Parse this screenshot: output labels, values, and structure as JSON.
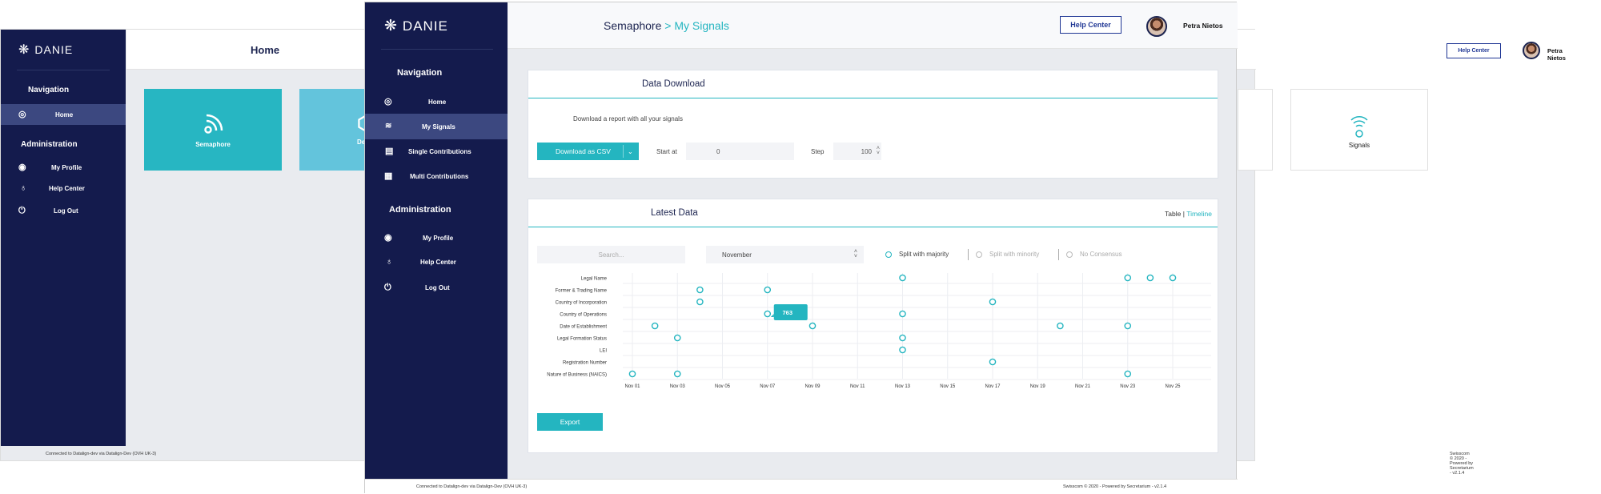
{
  "brand": {
    "name": "DANIE"
  },
  "left_screen": {
    "page_title": "Home",
    "nav_heading": "Navigation",
    "nav": [
      {
        "label": "Home"
      }
    ],
    "admin_heading": "Administration",
    "admin": [
      {
        "label": "My Profile"
      },
      {
        "label": "Help Center"
      },
      {
        "label": "Log Out"
      }
    ],
    "cards": [
      {
        "label": "Semaphore"
      },
      {
        "label": "De"
      },
      {
        "label": "Signals"
      }
    ],
    "footer_left": "Connected to Datalign-dev via Datalign-Dev (OVH UK-3)",
    "footer_right": "Swisscom © 2020 - Powered by Secretarium - v2.1.4",
    "help_button": "Help Center",
    "user_name": "Petra Nietos"
  },
  "main": {
    "breadcrumb": {
      "root": "Semaphore",
      "sep": ">",
      "current": "My Signals"
    },
    "help_button": "Help Center",
    "user_name": "Petra Nietos",
    "nav_heading": "Navigation",
    "nav": [
      {
        "label": "Home"
      },
      {
        "label": "My Signals"
      },
      {
        "label": "Single Contributions"
      },
      {
        "label": "Multi Contributions"
      }
    ],
    "admin_heading": "Administration",
    "admin": [
      {
        "label": "My Profile"
      },
      {
        "label": "Help Center"
      },
      {
        "label": "Log Out"
      }
    ],
    "download": {
      "title": "Data Download",
      "description": "Download a report with all your signals",
      "button": "Download as CSV",
      "start_label": "Start at",
      "start_value": "0",
      "step_label": "Step",
      "step_value": "100"
    },
    "latest": {
      "title": "Latest Data",
      "view_table": "Table",
      "view_sep": "|",
      "view_timeline": "Timeline",
      "search_placeholder": "Search...",
      "month": "November",
      "filters": [
        "Split with majority",
        "Split with minority",
        "No Consensus"
      ],
      "export": "Export"
    },
    "footer_left": "Connected to Datalign-dev via Datalign-Dev (OVH UK-3)",
    "footer_right": "Swisscom © 2020 - Powered by Secretarium - v2.1.4"
  },
  "chart_data": {
    "type": "scatter",
    "categories": [
      "Legal Name",
      "Former & Trading Name",
      "Country of Incorporation",
      "Country of Operations",
      "Date of Establishment",
      "Legal Formation Status",
      "LEI",
      "Registration Number",
      "Nature of Business (NAICS)"
    ],
    "x_ticks": [
      "Nov 01",
      "Nov 03",
      "Nov 05",
      "Nov 07",
      "Nov 09",
      "Nov 11",
      "Nov 13",
      "Nov 15",
      "Nov 17",
      "Nov 19",
      "Nov 21",
      "Nov 23",
      "Nov 25"
    ],
    "xlim": [
      1,
      25
    ],
    "points": [
      {
        "category": "Legal Name",
        "day": 13
      },
      {
        "category": "Legal Name",
        "day": 23
      },
      {
        "category": "Legal Name",
        "day": 24
      },
      {
        "category": "Legal Name",
        "day": 25
      },
      {
        "category": "Former & Trading Name",
        "day": 4
      },
      {
        "category": "Former & Trading Name",
        "day": 7
      },
      {
        "category": "Country of Incorporation",
        "day": 4
      },
      {
        "category": "Country of Incorporation",
        "day": 17
      },
      {
        "category": "Country of Operations",
        "day": 7
      },
      {
        "category": "Country of Operations",
        "day": 13
      },
      {
        "category": "Date of Establishment",
        "day": 2
      },
      {
        "category": "Date of Establishment",
        "day": 9
      },
      {
        "category": "Date of Establishment",
        "day": 20
      },
      {
        "category": "Date of Establishment",
        "day": 23
      },
      {
        "category": "Legal Formation Status",
        "day": 3
      },
      {
        "category": "Legal Formation Status",
        "day": 13
      },
      {
        "category": "LEI",
        "day": 13
      },
      {
        "category": "Registration Number",
        "day": 17
      },
      {
        "category": "Nature of Business (NAICS)",
        "day": 1
      },
      {
        "category": "Nature of Business (NAICS)",
        "day": 3
      },
      {
        "category": "Nature of Business (NAICS)",
        "day": 23
      }
    ],
    "tooltip": {
      "category": "Country of Operations",
      "day": 7,
      "value": "763"
    },
    "grid": true,
    "colors": {
      "point": "#24b5c0",
      "tooltip": "#24b5c0"
    }
  },
  "colors": {
    "navy": "#141b4d",
    "accent": "#24b5c0",
    "active": "#3c4880"
  }
}
